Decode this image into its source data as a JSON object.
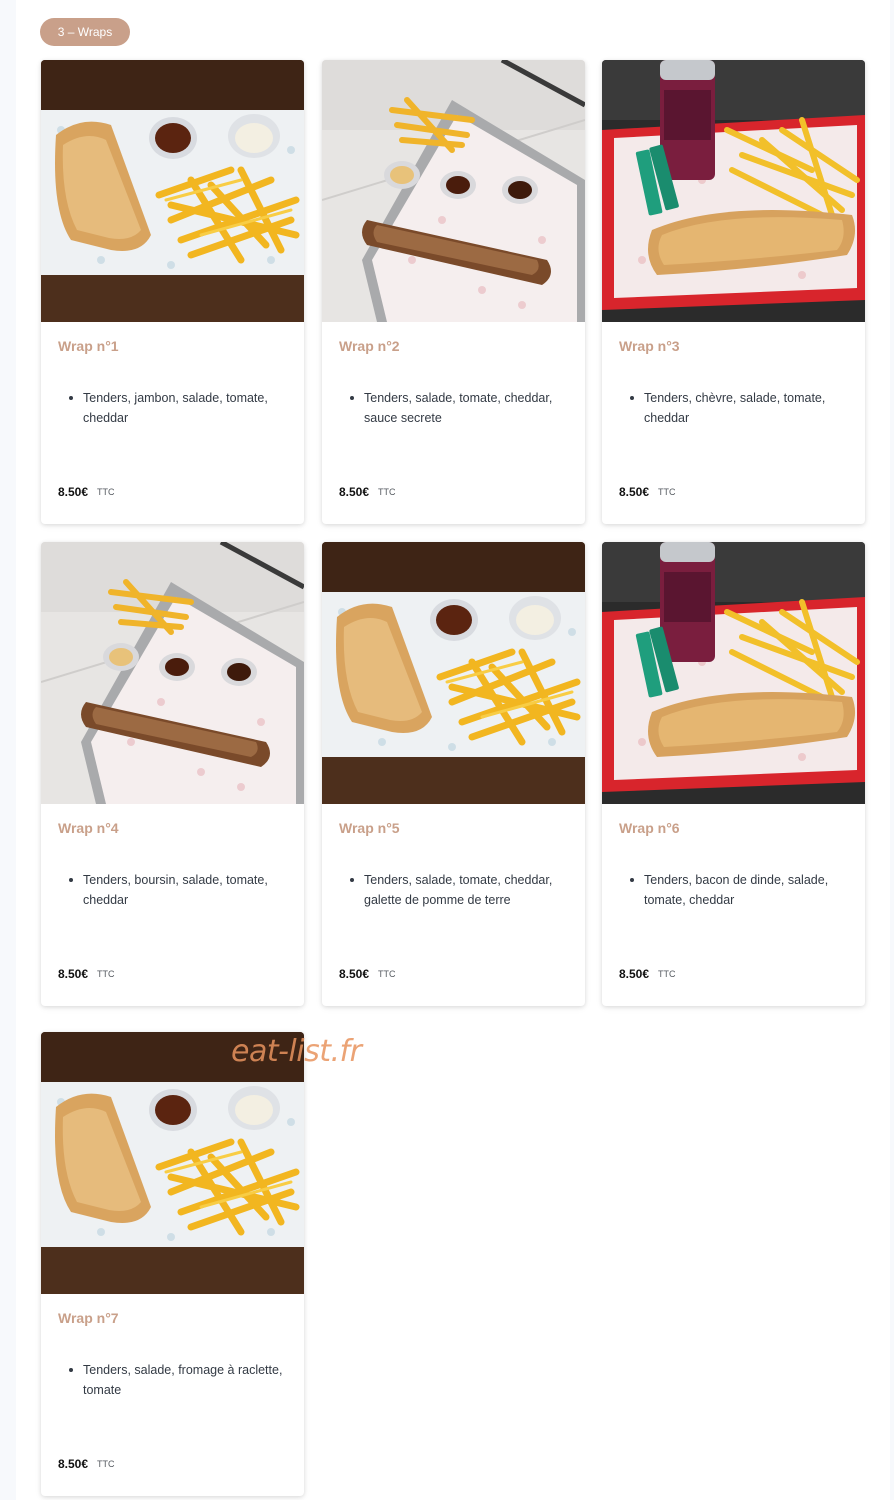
{
  "category": {
    "label": "3 – Wraps"
  },
  "watermark": "eat-list.fr",
  "colors": {
    "accent": "#c9a08a",
    "watermark": "#e8935e",
    "background": "#f7f9fc"
  },
  "products": [
    {
      "title": "Wrap n°1",
      "description": "Tenders, jambon, salade, tomate, cheddar",
      "price": "8.50€",
      "tax": "TTC",
      "photo": "wrap-fries-sauces-on-wood"
    },
    {
      "title": "Wrap n°2",
      "description": "Tenders, salade, tomate, cheddar, sauce secrete",
      "price": "8.50€",
      "tax": "TTC",
      "photo": "wrap-fries-sauces-on-tray"
    },
    {
      "title": "Wrap n°3",
      "description": "Tenders, chèvre, salade, tomate, cheddar",
      "price": "8.50€",
      "tax": "TTC",
      "photo": "wrap-fries-can-on-red-tray"
    },
    {
      "title": "Wrap n°4",
      "description": "Tenders, boursin, salade, tomate, cheddar",
      "price": "8.50€",
      "tax": "TTC",
      "photo": "wrap-fries-sauces-on-tray"
    },
    {
      "title": "Wrap n°5",
      "description": "Tenders, salade, tomate, cheddar, galette de pomme de terre",
      "price": "8.50€",
      "tax": "TTC",
      "photo": "wrap-fries-sauces-on-wood"
    },
    {
      "title": "Wrap n°6",
      "description": "Tenders, bacon de dinde, salade, tomate, cheddar",
      "price": "8.50€",
      "tax": "TTC",
      "photo": "wrap-fries-can-on-red-tray"
    },
    {
      "title": "Wrap n°7",
      "description": "Tenders, salade, fromage à raclette, tomate",
      "price": "8.50€",
      "tax": "TTC",
      "photo": "wrap-fries-sauces-on-wood"
    }
  ]
}
